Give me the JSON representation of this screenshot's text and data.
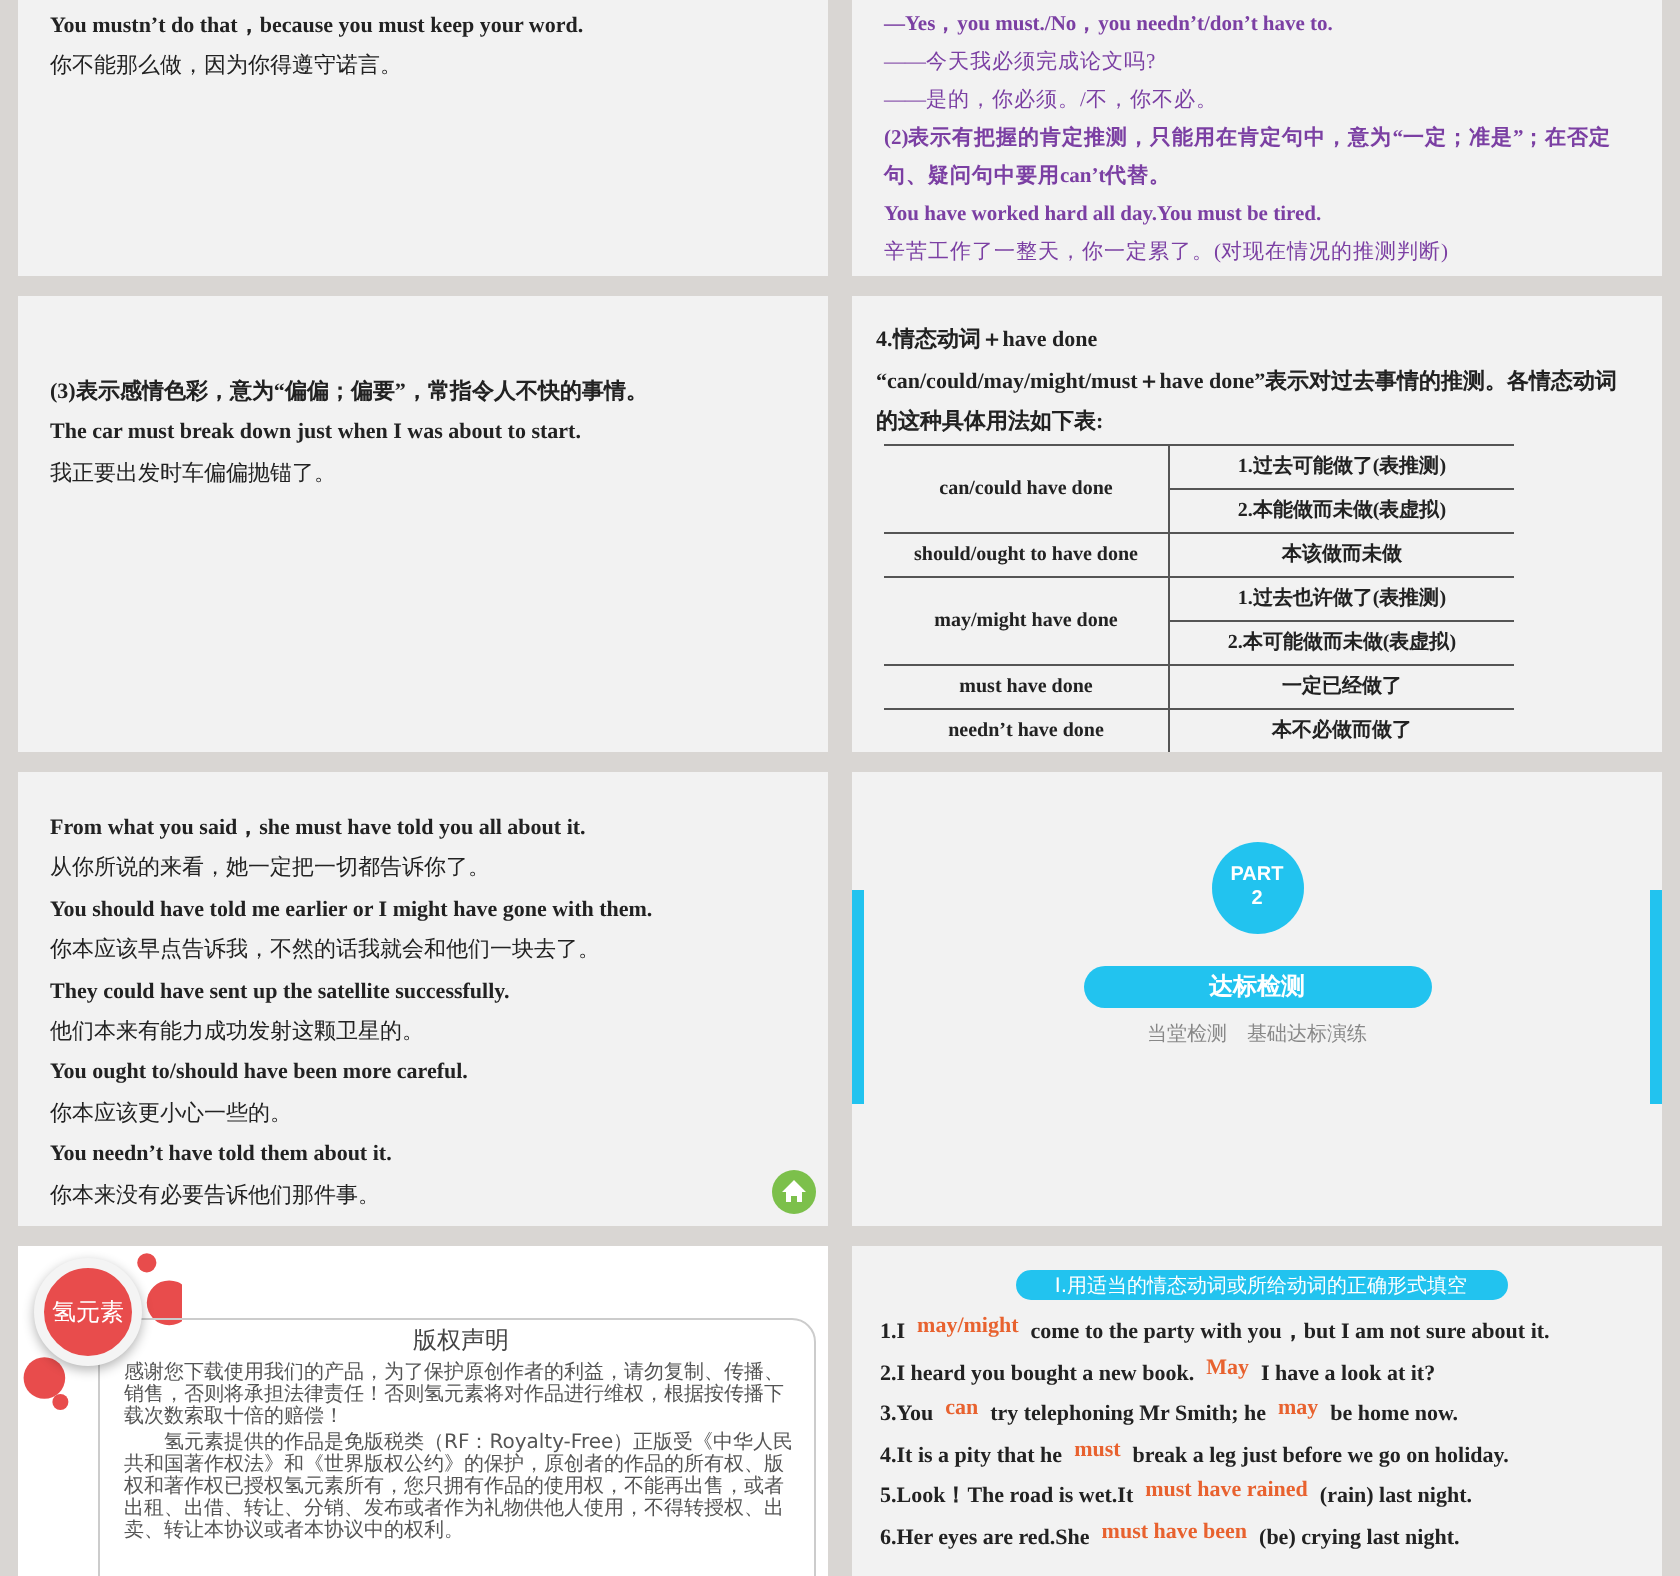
{
  "slides": [
    {
      "kind": "text",
      "lines": [
        {
          "kind": "bold",
          "text": "You mustn’t do that，because you must keep your word."
        },
        {
          "kind": "plain",
          "text": "你不能那么做，因为你得遵守诺言。"
        }
      ]
    },
    {
      "kind": "note",
      "lines": [
        {
          "kind": "bold",
          "text": "—Yes，you must./No，you needn’t/don’t have to."
        },
        {
          "kind": "plain",
          "text": "——今天我必须完成论文吗?"
        },
        {
          "kind": "plain",
          "text": "——是的，你必须。/不，你不必。"
        },
        {
          "kind": "bold",
          "text": "(2)表示有把握的肯定推测，只能用在肯定句中，意为“一定；准是”；在否定句、疑问句中要用can’t代替。"
        },
        {
          "kind": "bold",
          "text": "You have worked hard all day.You must be tired."
        },
        {
          "kind": "plain",
          "text": "辛苦工作了一整天，你一定累了。(对现在情况的推测判断)"
        }
      ]
    },
    {
      "kind": "text",
      "centered": true,
      "lines": [
        {
          "kind": "bold",
          "text": "(3)表示感情色彩，意为“偏偏；偏要”，常指令人不快的事情。"
        },
        {
          "kind": "bold",
          "text": "The car must break down just when I was about to start."
        },
        {
          "kind": "plain",
          "text": "我正要出发时车偏偏抛锚了。"
        }
      ]
    },
    {
      "kind": "table",
      "title": "4.情态动词＋have done",
      "intro": "“can/could/may/might/must＋have  done”表示对过去事情的推测。各情态动词的这种具体用法如下表:",
      "rows": [
        {
          "form": "can/could have done",
          "meanings": [
            "1.过去可能做了(表推测)",
            "2.本能做而未做(表虚拟)"
          ]
        },
        {
          "form": "should/ought to have done",
          "meanings": [
            "本该做而未做"
          ]
        },
        {
          "form": "may/might have done",
          "meanings": [
            "1.过去也许做了(表推测)",
            "2.本可能做而未做(表虚拟)"
          ]
        },
        {
          "form": "must have done",
          "meanings": [
            "一定已经做了"
          ]
        },
        {
          "form": "needn’t have done",
          "meanings": [
            "本不必做而做了"
          ]
        }
      ]
    },
    {
      "kind": "text",
      "home_button": true,
      "lines": [
        {
          "kind": "bold",
          "text": "From what you said，she must have told you all about it."
        },
        {
          "kind": "plain",
          "text": "从你所说的来看，她一定把一切都告诉你了。"
        },
        {
          "kind": "bold",
          "text": "You should have told me earlier or I might have gone with them."
        },
        {
          "kind": "plain",
          "text": "你本应该早点告诉我，不然的话我就会和他们一块去了。"
        },
        {
          "kind": "bold",
          "text": "They could have sent up the satellite successfully."
        },
        {
          "kind": "plain",
          "text": "他们本来有能力成功发射这颗卫星的。"
        },
        {
          "kind": "bold",
          "text": "You ought to/should have been more careful."
        },
        {
          "kind": "plain",
          "text": "你本应该更小心一些的。"
        },
        {
          "kind": "bold",
          "text": "You needn’t have told them about it."
        },
        {
          "kind": "plain",
          "text": "你本来没有必要告诉他们那件事。"
        }
      ]
    },
    {
      "kind": "section",
      "part_label": "PART",
      "part_number": "2",
      "title": "达标检测",
      "subtitle": "当堂检测　基础达标演练"
    },
    {
      "kind": "copyright",
      "logo": "氢元素",
      "title": "版权声明",
      "paragraphs": [
        "感谢您下载使用我们的产品，为了保护原创作者的利益，请勿复制、传播、销售，否则将承担法律责任！否则氢元素将对作品进行维权，根据按传播下载次数索取十倍的赔偿！",
        "氢元素提供的作品是免版税类（RF：Royalty-Free）正版受《中华人民共和国著作权法》和《世界版权公约》的保护，原创者的作品的所有权、版权和著作权已授权氢元素所有，您只拥有作品的使用权，不能再出售，或者出租、出借、转让、分销、发布或者作为礼物供他人使用，不得转授权、出卖、转让本协议或者本协议中的权利。"
      ]
    },
    {
      "kind": "exercise",
      "header": "Ⅰ.用适当的情态动词或所给动词的正确形式填空",
      "items": [
        [
          {
            "kind": "text",
            "text": "1.I"
          },
          {
            "kind": "answer",
            "text": "may/might"
          },
          {
            "kind": "text",
            "text": "come to the party with you，but I am not sure about it."
          }
        ],
        [
          {
            "kind": "text",
            "text": "2.I heard you bought a new book."
          },
          {
            "kind": "answer",
            "text": "May"
          },
          {
            "kind": "text",
            "text": "I have a look at it?"
          }
        ],
        [
          {
            "kind": "text",
            "text": "3.You"
          },
          {
            "kind": "answer",
            "text": "can"
          },
          {
            "kind": "text",
            "text": "try telephoning Mr Smith; he"
          },
          {
            "kind": "answer",
            "text": "may"
          },
          {
            "kind": "text",
            "text": "be home now."
          }
        ],
        [
          {
            "kind": "text",
            "text": "4.It is a pity that he"
          },
          {
            "kind": "answer",
            "text": "must"
          },
          {
            "kind": "text",
            "text": "break a leg just before we go on holiday."
          }
        ],
        [
          {
            "kind": "text",
            "text": "5.Look！The road is wet.It"
          },
          {
            "kind": "answer",
            "text": "must have rained"
          },
          {
            "kind": "text",
            "text": "(rain) last night."
          }
        ],
        [
          {
            "kind": "text",
            "text": "6.Her eyes are red.She"
          },
          {
            "kind": "answer",
            "text": "must have been"
          },
          {
            "kind": "text",
            "text": "(be) crying last night."
          }
        ]
      ]
    }
  ]
}
